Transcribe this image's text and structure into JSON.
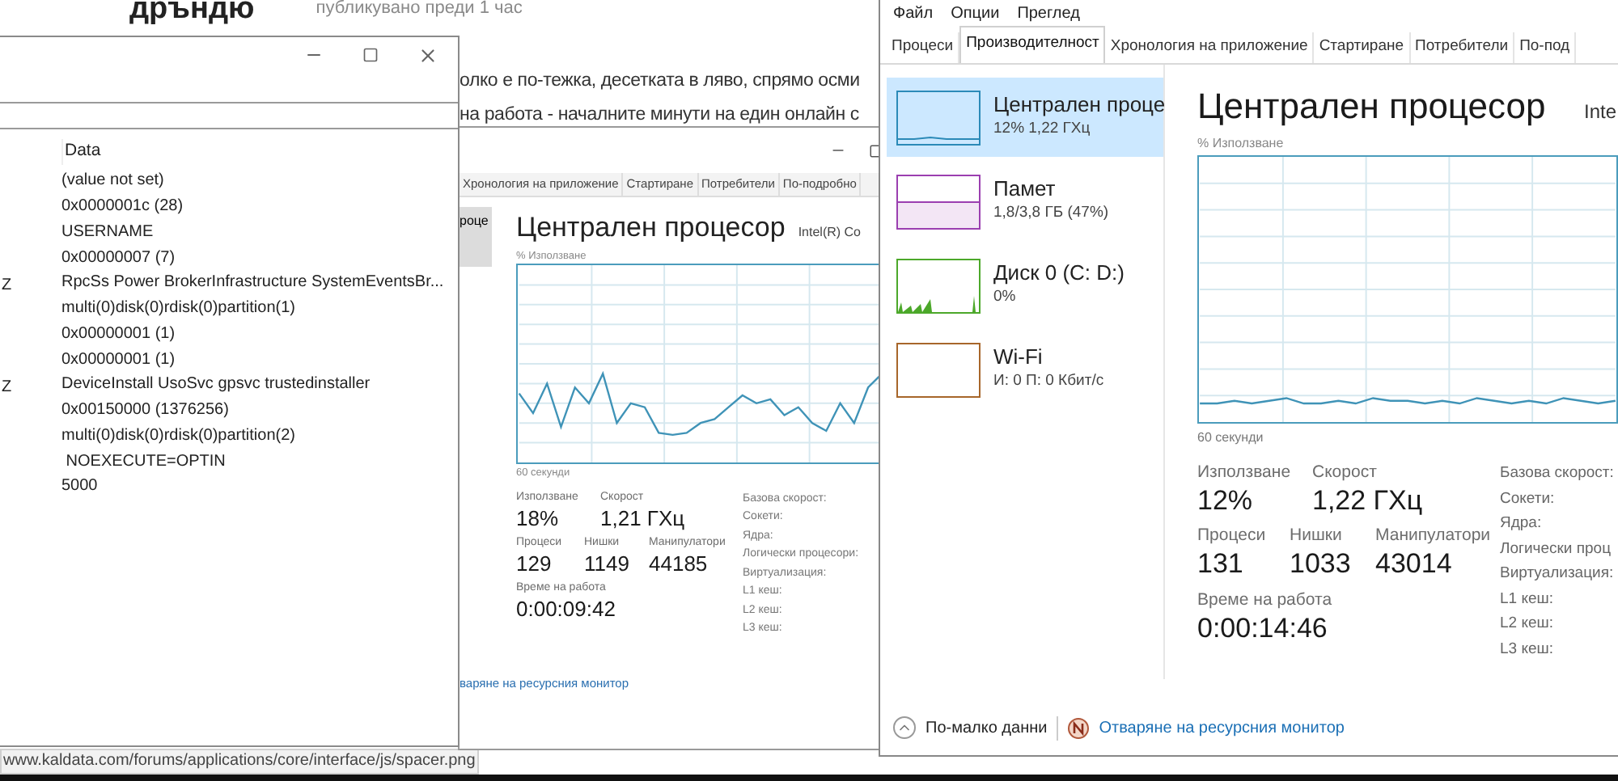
{
  "web_page": {
    "title": "дръндю",
    "posted": "публикувано преди 1 час",
    "paragraph_lines": [
      "олко е по-тежка, десетката в ляво, спрямо осми",
      "на работа - началните минути на един онлайн с"
    ],
    "status_url": "www.kaldata.com/forums/applications/core/interface/js/spacer.png"
  },
  "registry_window": {
    "column_header": "Data",
    "rows": [
      {
        "data": "(value not set)"
      },
      {
        "data": "0x0000001c (28)"
      },
      {
        "data": "USERNAME"
      },
      {
        "data": "0x00000007 (7)"
      },
      {
        "column_1": "Z",
        "data": "RpcSs Power BrokerInfrastructure SystemEventsBr..."
      },
      {
        "data": "multi(0)disk(0)rdisk(0)partition(1)"
      },
      {
        "data": "0x00000001 (1)"
      },
      {
        "data": "0x00000001 (1)"
      },
      {
        "column_1": "Z",
        "data": "DeviceInstall UsoSvc gpsvc trustedinstaller"
      },
      {
        "data": "0x00150000 (1376256)"
      },
      {
        "data": "multi(0)disk(0)rdisk(0)partition(2)"
      },
      {
        "data": " NOEXECUTE=OPTIN"
      },
      {
        "data": "5000"
      }
    ]
  },
  "background_task_manager": {
    "tabs": [
      {
        "label": "Хронология на приложение",
        "selected": false
      },
      {
        "label": "Стартиране",
        "selected": false
      },
      {
        "label": "Потребители",
        "selected": false
      },
      {
        "label": "По-подробно",
        "selected": false
      }
    ],
    "sidebar_item": {
      "label": "роце",
      "selected": true
    },
    "heading": "Централен процесор",
    "cpu_model": "Intel(R) Co",
    "graph_label": "% Използване",
    "time_span": "60 секунди",
    "stat_rows": [
      [
        {
          "label": "Използване",
          "value": "18%"
        },
        {
          "label": "Скорост",
          "value": "1,21 ГХц"
        }
      ],
      [
        {
          "label": "Процеси",
          "value": "129"
        },
        {
          "label": "Нишки",
          "value": "1149"
        },
        {
          "label": "Манипулатори",
          "value": "44185"
        }
      ],
      [
        {
          "label": "Време на работа",
          "value": "0:00:09:42"
        }
      ]
    ],
    "details": [
      "Базова скорост:",
      "Сокети:",
      "Ядра:",
      "Логически процесори:",
      "Виртуализация:",
      "L1 кеш:",
      "L2 кеш:",
      "L3 кеш:"
    ],
    "link": "варяне на ресурсния монитор"
  },
  "task_manager": {
    "menu": [
      "Файл",
      "Опции",
      "Преглед"
    ],
    "tabs": [
      {
        "label": "Процеси",
        "selected": false
      },
      {
        "label": "Производителност",
        "selected": true
      },
      {
        "label": "Хронология на приложение",
        "selected": false
      },
      {
        "label": "Стартиране",
        "selected": false
      },
      {
        "label": "Потребители",
        "selected": false
      },
      {
        "label": "По-под",
        "selected": false
      }
    ],
    "sidebar": [
      {
        "kind": "cpu",
        "name": "Централен проце",
        "detail": "12% 1,22 ГХц",
        "color": "#2b8ab8",
        "selected": true
      },
      {
        "kind": "memory",
        "name": "Памет",
        "detail": "1,8/3,8 ГБ (47%)",
        "color": "#9b3fb0",
        "selected": false
      },
      {
        "kind": "disk",
        "name": "Диск 0 (C: D:)",
        "detail": "0%",
        "color": "#4ca82a",
        "selected": false
      },
      {
        "kind": "network",
        "name": "Wi-Fi",
        "detail": "И: 0 П: 0 Кбит/с",
        "color": "#a7662a",
        "selected": false
      }
    ],
    "heading": "Централен процесор",
    "cpu_model": "Inte",
    "graph_label": "% Използване",
    "time_span": "60 секунди",
    "stat_rows": [
      [
        {
          "label": "Използване",
          "value": "12%"
        },
        {
          "label": "Скорост",
          "value": "1,22 ГХц"
        }
      ],
      [
        {
          "label": "Процеси",
          "value": "131"
        },
        {
          "label": "Нишки",
          "value": "1033"
        },
        {
          "label": "Манипулатори",
          "value": "43014"
        }
      ],
      [
        {
          "label": "Време на работа",
          "value": "0:00:14:46"
        }
      ]
    ],
    "details": [
      "Базова скорост:",
      "Сокети:",
      "Ядра:",
      "Логически проц",
      "Виртуализация:",
      "L1 кеш:",
      "L2 кеш:",
      "L3 кеш:"
    ],
    "footer": {
      "toggle": "По-малко данни",
      "link": "Отваряне на ресурсния монитор"
    }
  }
}
